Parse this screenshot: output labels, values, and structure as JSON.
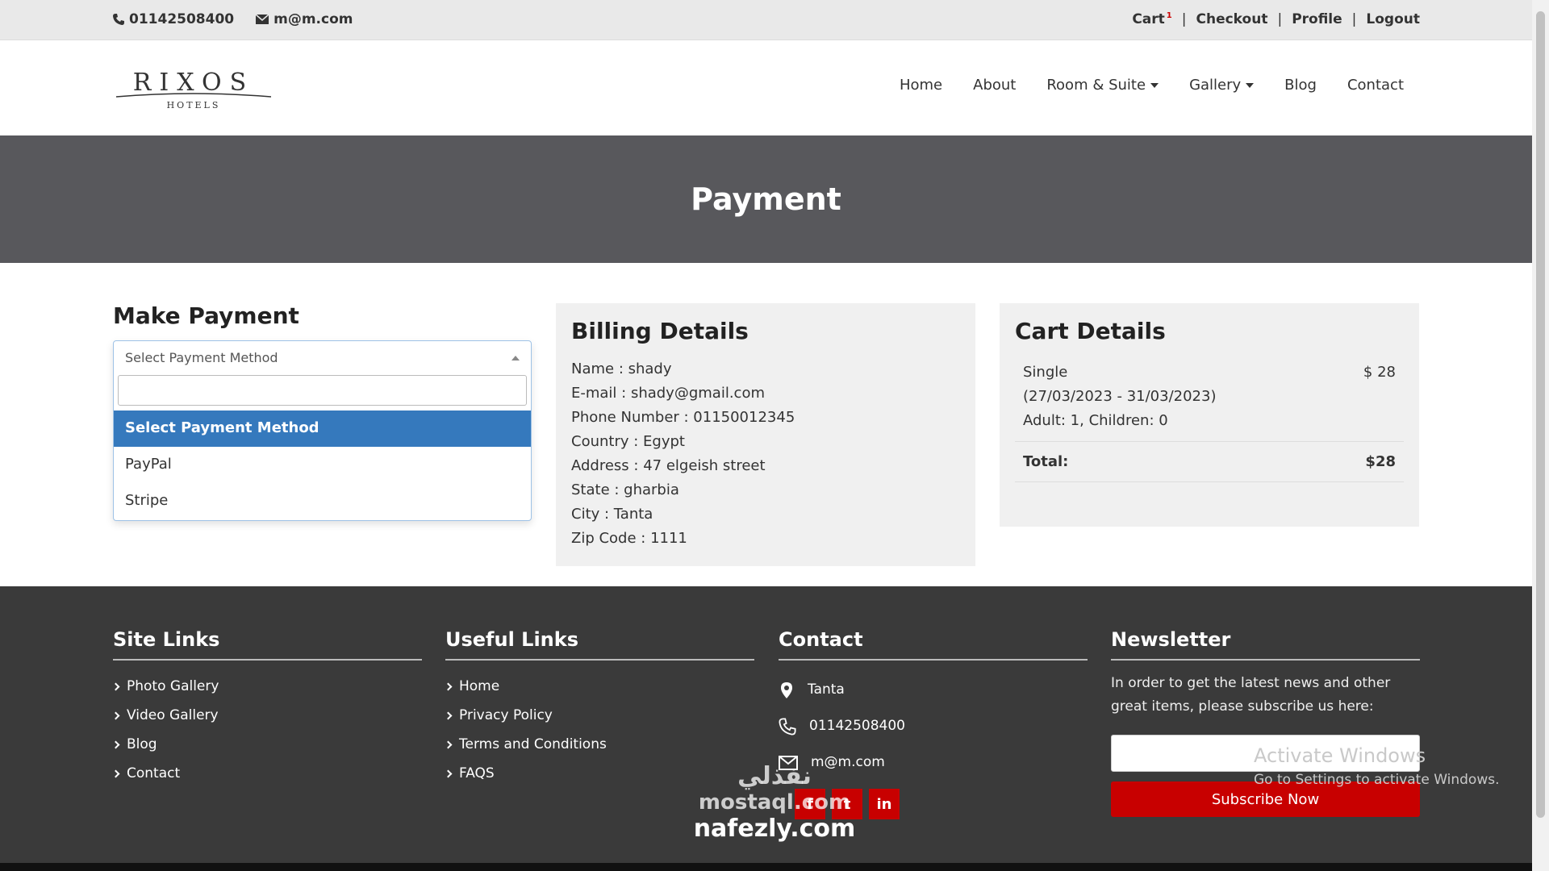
{
  "topbar": {
    "phone": "01142508400",
    "email": "m@m.com",
    "cart_label": "Cart",
    "cart_count": "1",
    "checkout_label": "Checkout",
    "profile_label": "Profile",
    "logout_label": "Logout",
    "separator": "|"
  },
  "header": {
    "logo_text": "RIXOS",
    "logo_sub": "HOTELS",
    "nav": [
      "Home",
      "About",
      "Room & Suite",
      "Gallery",
      "Blog",
      "Contact"
    ]
  },
  "banner": {
    "title": "Payment"
  },
  "payment": {
    "heading": "Make Payment",
    "selected": "Select Payment Method",
    "options": [
      "Select Payment Method",
      "PayPal",
      "Stripe"
    ]
  },
  "billing": {
    "heading": "Billing Details",
    "lines": [
      "Name : shady",
      "E-mail : shady@gmail.com",
      "Phone Number : 01150012345",
      "Country : Egypt",
      "Address : 47 elgeish street",
      "State : gharbia",
      "City : Tanta",
      "Zip Code : 1111"
    ]
  },
  "cart": {
    "heading": "Cart Details",
    "item_name": "Single",
    "item_dates": "(27/03/2023 - 31/03/2023)",
    "item_guests": "Adult: 1, Children: 0",
    "item_price": "$ 28",
    "total_label": "Total:",
    "total_value": "$28"
  },
  "footer": {
    "site_links": {
      "heading": "Site Links",
      "items": [
        "Photo Gallery",
        "Video Gallery",
        "Blog",
        "Contact"
      ]
    },
    "useful_links": {
      "heading": "Useful Links",
      "items": [
        "Home",
        "Privacy Policy",
        "Terms and Conditions",
        "FAQS"
      ]
    },
    "contact": {
      "heading": "Contact",
      "location": "Tanta",
      "phone": "01142508400",
      "email": "m@m.com"
    },
    "newsletter": {
      "heading": "Newsletter",
      "text": "In order to get the latest news and other great items, please subscribe us here:",
      "button": "Subscribe Now"
    },
    "social": [
      "f",
      "t",
      "in"
    ]
  },
  "overlay": {
    "activate_title": "Activate Windows",
    "activate_sub": "Go to Settings to activate Windows.",
    "watermark_arabic": "نفذلي",
    "watermark_1": "mostaql.com",
    "watermark_2": "nafezly.com"
  },
  "colors": {
    "accent": "#c80000",
    "select_highlight": "#3579bd",
    "banner": "#58585c",
    "footer": "#3a3a3a"
  }
}
